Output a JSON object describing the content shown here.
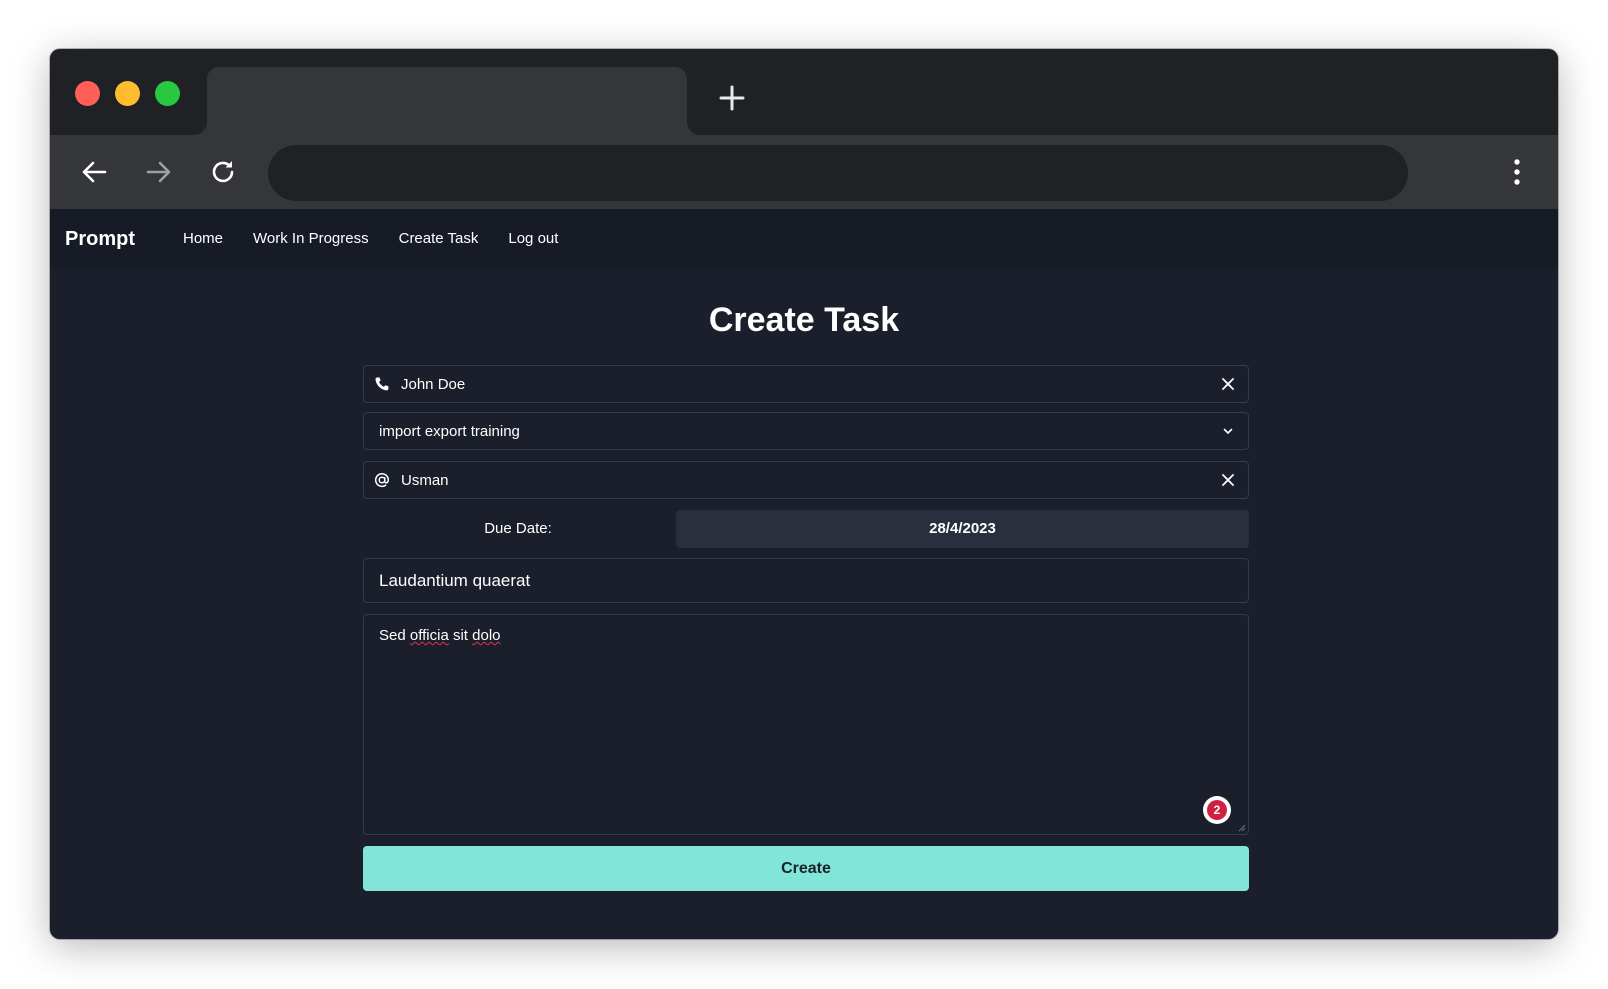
{
  "browser": {
    "tab_title": "",
    "address": "",
    "icons": {
      "new_tab": "plus-icon",
      "back": "arrow-left-icon",
      "forward": "arrow-right-icon",
      "reload": "reload-icon",
      "menu": "kebab-menu-icon"
    }
  },
  "nav": {
    "brand": "Prompt",
    "links": [
      "Home",
      "Work In Progress",
      "Create Task",
      "Log out"
    ]
  },
  "main": {
    "title": "Create Task",
    "assignee": {
      "value": "John Doe",
      "icon": "phone-icon",
      "clear_icon": "close-icon"
    },
    "training": {
      "value": "import export training",
      "icon": "chevron-down-icon"
    },
    "mention": {
      "value": "Usman",
      "icon": "at-icon",
      "clear_icon": "close-icon"
    },
    "due_date": {
      "label": "Due Date:",
      "value": "28/4/2023"
    },
    "task_title": "Laudantium quaerat",
    "description": {
      "word1": "Sed",
      "word2": "officia",
      "word3": "sit",
      "word4": "dolo"
    },
    "grammar_count": "2",
    "create_label": "Create"
  },
  "colors": {
    "page_bg": "#1b1f2b",
    "nav_bg": "#171b26",
    "accent": "#81e6d9",
    "badge_red": "#d1203f"
  }
}
